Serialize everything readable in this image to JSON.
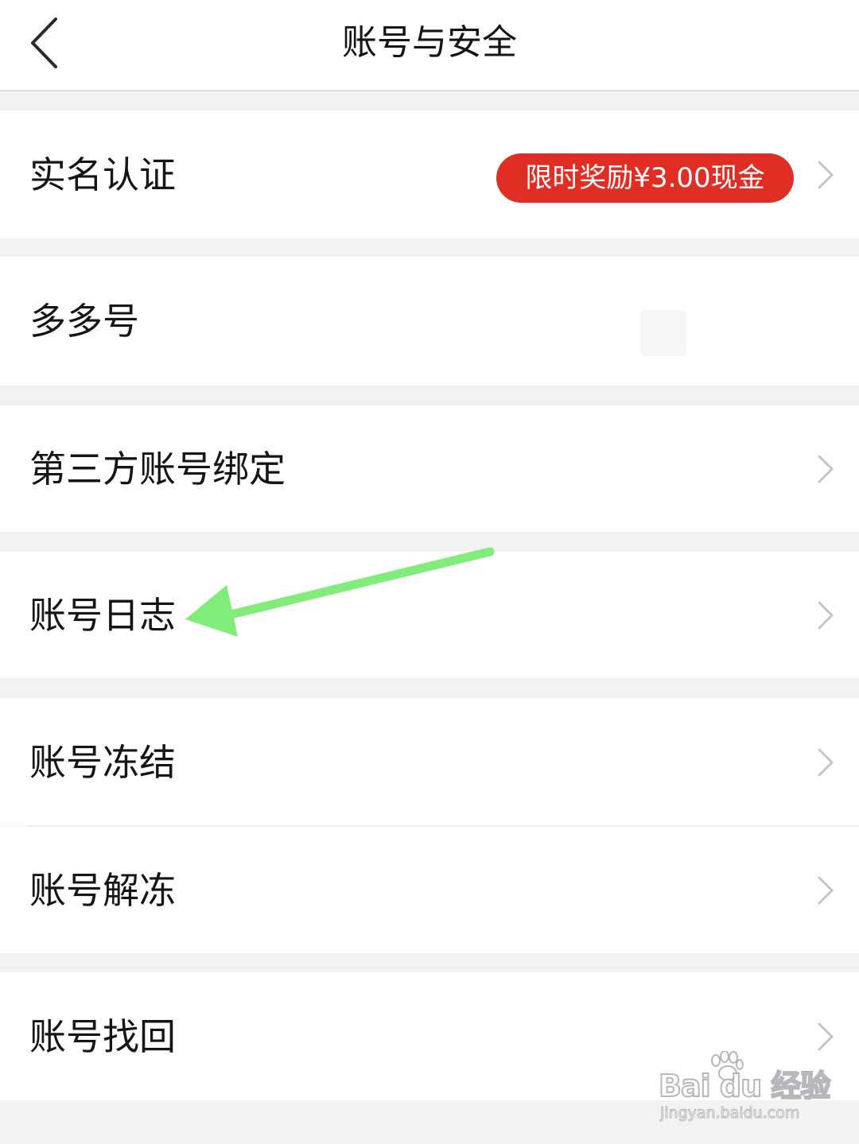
{
  "header": {
    "title": "账号与安全",
    "back_icon": "chevron-left-icon"
  },
  "settings": {
    "real_name": {
      "label": "实名认证",
      "badge": "限时奖励¥3.00现金",
      "badge_color": "#e02e24"
    },
    "duoduo_id": {
      "label": "多多号"
    },
    "third_party": {
      "label": "第三方账号绑定"
    },
    "account_log": {
      "label": "账号日志"
    },
    "account_freeze": {
      "label": "账号冻结"
    },
    "account_unfreeze": {
      "label": "账号解冻"
    },
    "account_recover": {
      "label": "账号找回"
    }
  },
  "annotation": {
    "arrow_color": "#82ec7a",
    "points_to": "账号日志"
  },
  "watermark": {
    "brand": "Bai du 经验",
    "url": "jingyan.baidu.com"
  }
}
